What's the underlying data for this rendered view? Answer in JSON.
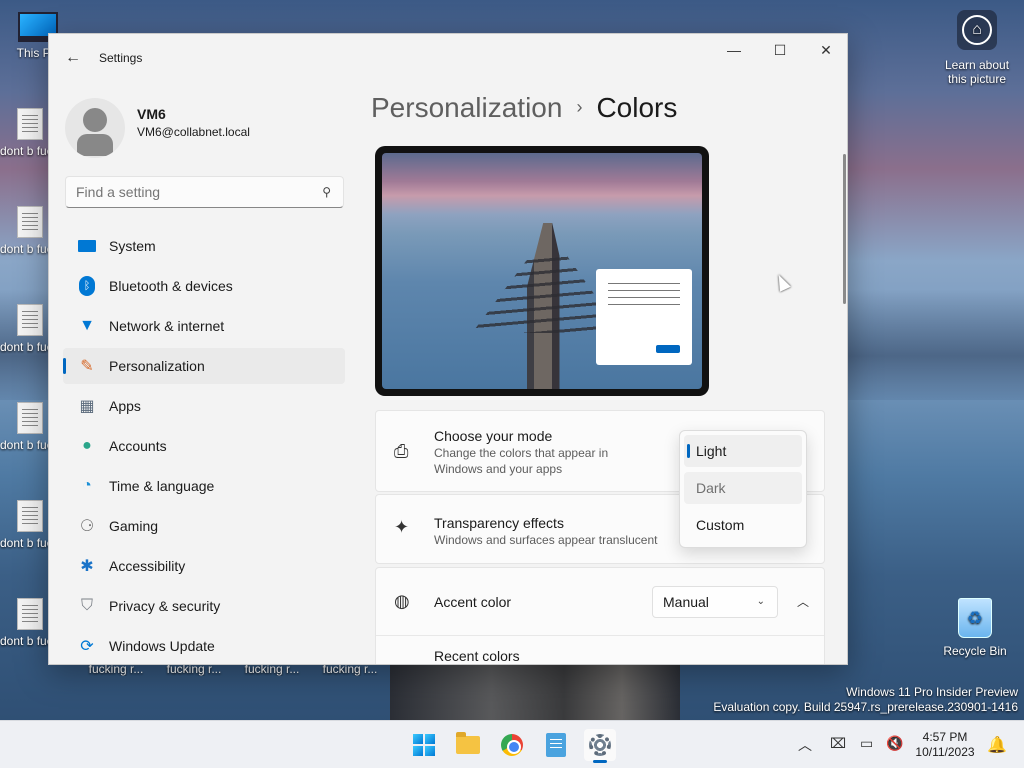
{
  "desktop": {
    "icons": [
      {
        "label": "This PC"
      },
      {
        "label": "dont b fucking"
      },
      {
        "label": "dont b fucking"
      },
      {
        "label": "dont b fucking"
      },
      {
        "label": "dont b fucking"
      },
      {
        "label": "dont b fucking"
      },
      {
        "label": "dont b fucking r..."
      }
    ],
    "bottom_labels": [
      "fucking r...",
      "fucking r...",
      "fucking r...",
      "fucking r..."
    ],
    "learn": {
      "line1": "Learn about",
      "line2": "this picture"
    },
    "recycle_bin": "Recycle Bin",
    "watermark": {
      "line1": "Windows 11 Pro Insider Preview",
      "line2": "Evaluation copy. Build 25947.rs_prerelease.230901-1416"
    }
  },
  "window": {
    "title": "Settings",
    "controls": {
      "minimize": "—",
      "maximize": "☐",
      "close": "✕"
    }
  },
  "profile": {
    "name": "VM6",
    "email": "VM6@collabnet.local"
  },
  "search": {
    "placeholder": "Find a setting"
  },
  "nav": [
    {
      "label": "System",
      "icon": "system-icon"
    },
    {
      "label": "Bluetooth & devices",
      "icon": "bluetooth-icon"
    },
    {
      "label": "Network & internet",
      "icon": "wifi-icon"
    },
    {
      "label": "Personalization",
      "icon": "brush-icon",
      "selected": true
    },
    {
      "label": "Apps",
      "icon": "apps-icon"
    },
    {
      "label": "Accounts",
      "icon": "person-icon"
    },
    {
      "label": "Time & language",
      "icon": "globe-clock-icon"
    },
    {
      "label": "Gaming",
      "icon": "gamepad-icon"
    },
    {
      "label": "Accessibility",
      "icon": "accessibility-icon"
    },
    {
      "label": "Privacy & security",
      "icon": "shield-icon"
    },
    {
      "label": "Windows Update",
      "icon": "update-icon"
    }
  ],
  "breadcrumb": {
    "parent": "Personalization",
    "separator": "›",
    "current": "Colors"
  },
  "mode": {
    "title": "Choose your mode",
    "description": "Change the colors that appear in Windows and your apps",
    "options": [
      "Light",
      "Dark",
      "Custom"
    ],
    "selected": "Light"
  },
  "transparency": {
    "title": "Transparency effects",
    "description": "Windows and surfaces appear translucent"
  },
  "accent": {
    "title": "Accent color",
    "value": "Manual",
    "recent_colors_label": "Recent colors"
  },
  "taskbar": {
    "time": "4:57 PM",
    "date": "10/11/2023",
    "accent_color": "#0067c0"
  }
}
